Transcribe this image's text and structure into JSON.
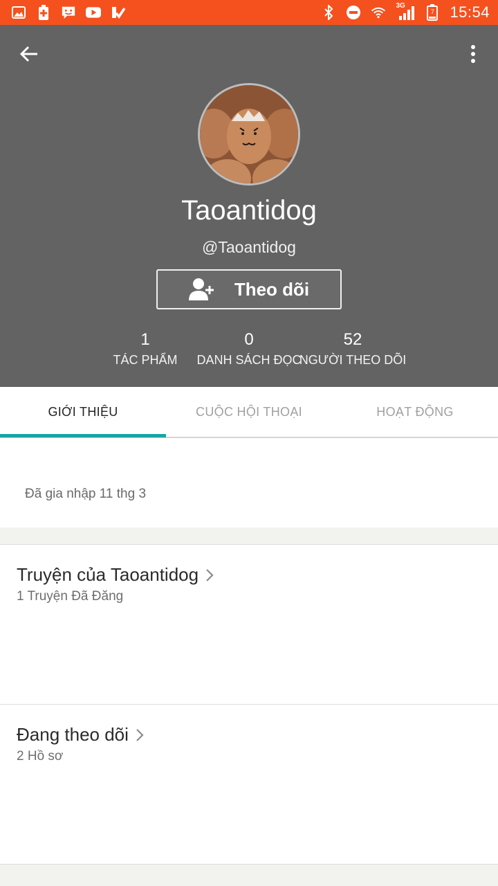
{
  "status_bar": {
    "time": "15:54",
    "network": "3G",
    "battery_level": "7",
    "left_icons": [
      "gallery-icon",
      "battery-saver-icon",
      "messenger-icon",
      "youtube-icon",
      "check-app-icon"
    ],
    "right_icons": [
      "bluetooth-icon",
      "do-not-disturb-icon",
      "wifi-icon",
      "signal-icon",
      "battery-icon"
    ],
    "color": "#f4511e"
  },
  "header": {
    "background": "#636363",
    "display_name": "Taoantidog",
    "username": "@Taoantidog",
    "follow_button_label": "Theo dõi",
    "stats": [
      {
        "value": "1",
        "label": "TÁC PHẨM"
      },
      {
        "value": "0",
        "label": "DANH SÁCH ĐỌC"
      },
      {
        "value": "52",
        "label": "NGƯỜI THEO DÕI"
      }
    ]
  },
  "tabs": [
    {
      "label": "GIỚI THIỆU",
      "active": true
    },
    {
      "label": "CUỘC HỘI THOẠI",
      "active": false
    },
    {
      "label": "HOẠT ĐỘNG",
      "active": false
    }
  ],
  "accent_color": "#19a5a2",
  "about": {
    "joined": "Đã gia nhập 11 thg 3"
  },
  "sections": [
    {
      "title": "Truyện của Taoantidog",
      "subtitle": "1 Truyện Đã Đăng"
    },
    {
      "title": "Đang theo dõi",
      "subtitle": "2 Hồ sơ"
    }
  ]
}
